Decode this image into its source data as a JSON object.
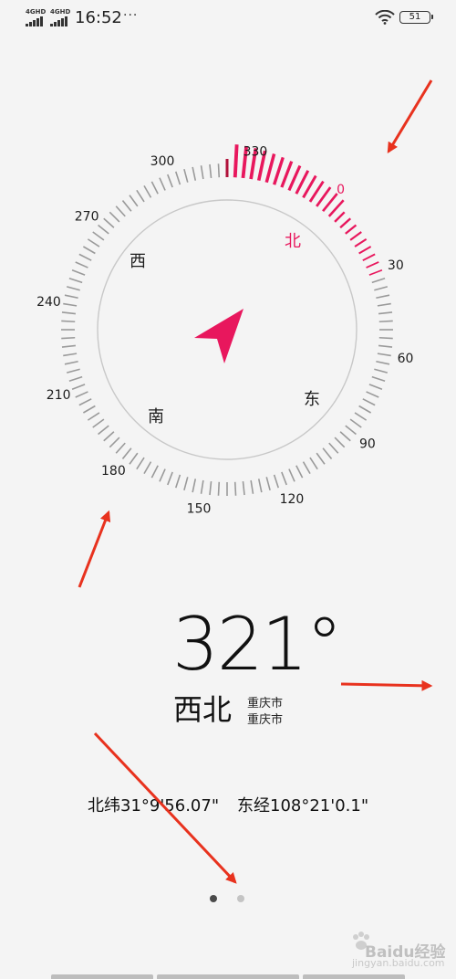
{
  "status_bar": {
    "sim1_label": "4GHD",
    "sim2_label": "4GHD",
    "time": "16:52",
    "more": "···",
    "battery": "51"
  },
  "compass": {
    "tick_labels": [
      "0",
      "30",
      "60",
      "90",
      "120",
      "150",
      "180",
      "210",
      "240",
      "270",
      "300",
      "330"
    ],
    "cardinals": {
      "north": "北",
      "east": "东",
      "south": "南",
      "west": "西"
    },
    "heading_degrees": 321,
    "accent_color": "#e8175d"
  },
  "readout": {
    "heading": "321°",
    "direction": "西北",
    "city_line1": "重庆市",
    "city_line2": "重庆市"
  },
  "coordinates": {
    "latitude": "北纬31°9'56.07\"",
    "longitude": "东经108°21'0.1\""
  },
  "pager": {
    "page_count": 2,
    "current_page": 1
  },
  "watermark": {
    "text": "Baidu经验",
    "sub": "jingyan.baidu.com"
  },
  "annotation_color": "#e8321e"
}
